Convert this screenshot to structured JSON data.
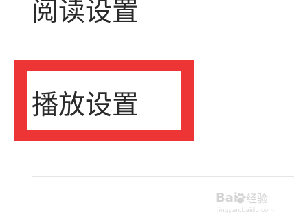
{
  "settings_menu": {
    "items": [
      {
        "label": "阅读设置"
      },
      {
        "label": "播放设置"
      }
    ]
  },
  "annotation": {
    "highlight_color": "#ee3535"
  },
  "watermark": {
    "logo_text": "Bai",
    "logo_suffix": "经验",
    "url": "jingyan.baidu.com"
  }
}
